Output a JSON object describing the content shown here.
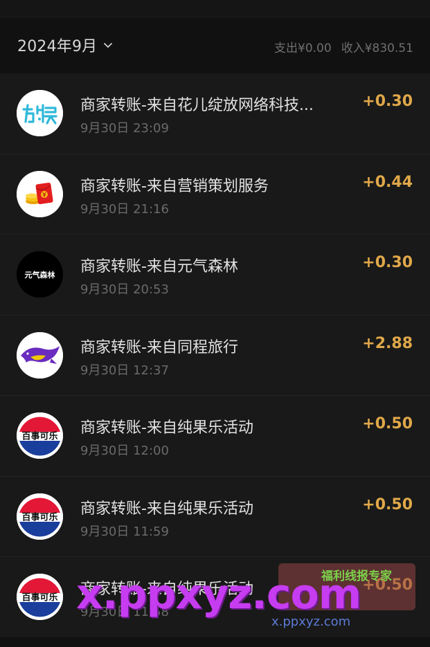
{
  "header": {
    "month": "2024年9月",
    "expense": "支出¥0.00",
    "income": "收入¥830.51"
  },
  "transactions": [
    {
      "title": "商家转账-来自花儿绽放网络科技...",
      "time": "9月30日 23:09",
      "amount": "+0.30",
      "icon": "youyu-logo-icon"
    },
    {
      "title": "商家转账-来自营销策划服务",
      "time": "9月30日 21:16",
      "amount": "+0.44",
      "icon": "red-envelope-icon"
    },
    {
      "title": "商家转账-来自元气森林",
      "time": "9月30日 20:53",
      "amount": "+0.30",
      "icon": "genki-forest-logo-icon",
      "icon_text": "元气森林"
    },
    {
      "title": "商家转账-来自同程旅行",
      "time": "9月30日 12:37",
      "amount": "+2.88",
      "icon": "tongcheng-logo-icon"
    },
    {
      "title": "商家转账-来自纯果乐活动",
      "time": "9月30日 12:00",
      "amount": "+0.50",
      "icon": "pepsi-logo-icon",
      "icon_text": "百事可乐"
    },
    {
      "title": "商家转账-来自纯果乐活动",
      "time": "9月30日 11:59",
      "amount": "+0.50",
      "icon": "pepsi-logo-icon",
      "icon_text": "百事可乐"
    },
    {
      "title": "商家转账-来自纯果乐活动",
      "time": "9月30日 11:58",
      "amount": "+0.50",
      "icon": "pepsi-logo-icon",
      "icon_text": "百事可乐"
    }
  ],
  "watermark": {
    "main": "x.ppxyz.com",
    "sub": "x.ppxyz.com",
    "badge": "福利线报专家"
  },
  "colors": {
    "background": "#111111",
    "row": "#191919",
    "amount": "#e0a84a",
    "title": "#e2e2e2",
    "muted": "#6a6a6a"
  }
}
